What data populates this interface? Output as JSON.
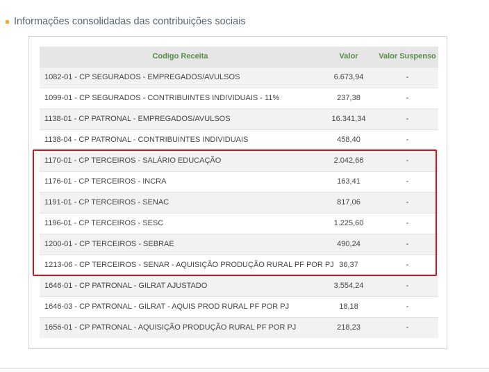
{
  "section": {
    "title": "Informações consolidadas das contribuições sociais",
    "bullet_color": "#f0a830"
  },
  "table": {
    "headers": {
      "code": "Codigo Receita",
      "value": "Valor",
      "suspended": "Valor Suspenso"
    },
    "header_color": "#5a8a4c",
    "rows": [
      {
        "code": "1082-01 - CP SEGURADOS - EMPREGADOS/AVULSOS",
        "value": "6.673,94",
        "suspended": "-"
      },
      {
        "code": "1099-01 - CP SEGURADOS - CONTRIBUINTES INDIVIDUAIS - 11%",
        "value": "237,38",
        "suspended": "-"
      },
      {
        "code": "1138-01 - CP PATRONAL - EMPREGADOS/AVULSOS",
        "value": "16.341,34",
        "suspended": "-"
      },
      {
        "code": "1138-04 - CP PATRONAL - CONTRIBUINTES INDIVIDUAIS",
        "value": "458,40",
        "suspended": "-"
      },
      {
        "code": "1170-01 - CP TERCEIROS - SALÁRIO EDUCAÇÃO",
        "value": "2.042,66",
        "suspended": "-"
      },
      {
        "code": "1176-01 - CP TERCEIROS - INCRA",
        "value": "163,41",
        "suspended": "-"
      },
      {
        "code": "1191-01 - CP TERCEIROS - SENAC",
        "value": "817,06",
        "suspended": "-"
      },
      {
        "code": "1196-01 - CP TERCEIROS - SESC",
        "value": "1.225,60",
        "suspended": "-"
      },
      {
        "code": "1200-01 - CP TERCEIROS - SEBRAE",
        "value": "490,24",
        "suspended": "-"
      },
      {
        "code": "1213-06 - CP TERCEIROS - SENAR - AQUISIÇÃO PRODUÇÃO RURAL PF POR PJ",
        "value": "36,37",
        "suspended": "-"
      },
      {
        "code": "1646-01 - CP PATRONAL - GILRAT AJUSTADO",
        "value": "3.554,24",
        "suspended": "-"
      },
      {
        "code": "1646-03 - CP PATRONAL - GILRAT - AQUIS PROD RURAL PF POR PJ",
        "value": "18,18",
        "suspended": "-"
      },
      {
        "code": "1656-01 - CP PATRONAL - AQUISIÇÃO PRODUÇÃO RURAL PF POR PJ",
        "value": "218,23",
        "suspended": "-"
      }
    ]
  },
  "highlight": {
    "color": "#d0161b"
  }
}
